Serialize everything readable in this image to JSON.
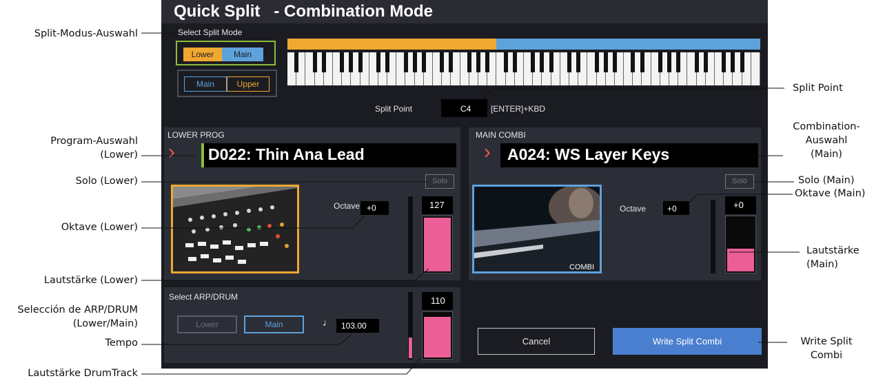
{
  "screen": {
    "title": "Quick Split   - Combination Mode",
    "split_mode": {
      "label": "Select Split Mode",
      "option1": {
        "left": "Lower",
        "right": "Main"
      },
      "option2": {
        "left": "Main",
        "right": "Upper"
      }
    },
    "split_point": {
      "label": "Split Point",
      "value": "C4",
      "hint": "[ENTER]+KBD"
    },
    "lower": {
      "header": "LOWER PROG",
      "program": "D022: Thin Ana Lead",
      "solo": "Solo",
      "octave_label": "Octave",
      "octave": "+0",
      "volume": "127",
      "volume_level": 1.0
    },
    "main": {
      "header": "MAIN COMBI",
      "program": "A024: WS Layer Keys",
      "solo": "Solo",
      "octave_label": "Octave",
      "octave": "+0",
      "volume": "+0",
      "image_label": "COMBI",
      "volume_level": 0.42
    },
    "arp": {
      "header": "Select ARP/DRUM",
      "lower": "Lower",
      "main": "Main",
      "note_icon": "♩",
      "tempo": "103.00",
      "drum_volume": "110",
      "drum_level": 0.9
    },
    "cancel": "Cancel",
    "write": "Write Split Combi"
  },
  "callouts": {
    "split_mode": "Split-Modus-Auswahl",
    "split_point": "Split Point",
    "program_lower_1": "Program-Auswahl",
    "program_lower_2": "(Lower)",
    "combi_main_1": "Combination-",
    "combi_main_2": "Auswahl",
    "combi_main_3": "(Main)",
    "solo_lower": "Solo (Lower)",
    "solo_main": "Solo (Main)",
    "octave_main": "Oktave (Main)",
    "octave_lower": "Oktave (Lower)",
    "volume_main_1": "Lautstärke",
    "volume_main_2": "(Main)",
    "volume_lower": "Lautstärke (Lower)",
    "arp_1": "Selección de ARP/DRUM",
    "arp_2": "(Lower/Main)",
    "tempo": "Tempo",
    "write_1": "Write Split",
    "write_2": "Combi",
    "drum_volume": "Lautstärke DrumTrack"
  },
  "colors": {
    "lower_orange": "#f0a830",
    "main_blue": "#5ea2dc",
    "volume_pink": "#ec5f96",
    "write_button": "#4a7fd0",
    "select_green": "#8fbc3a",
    "screen_bg": "#1b1c22"
  }
}
